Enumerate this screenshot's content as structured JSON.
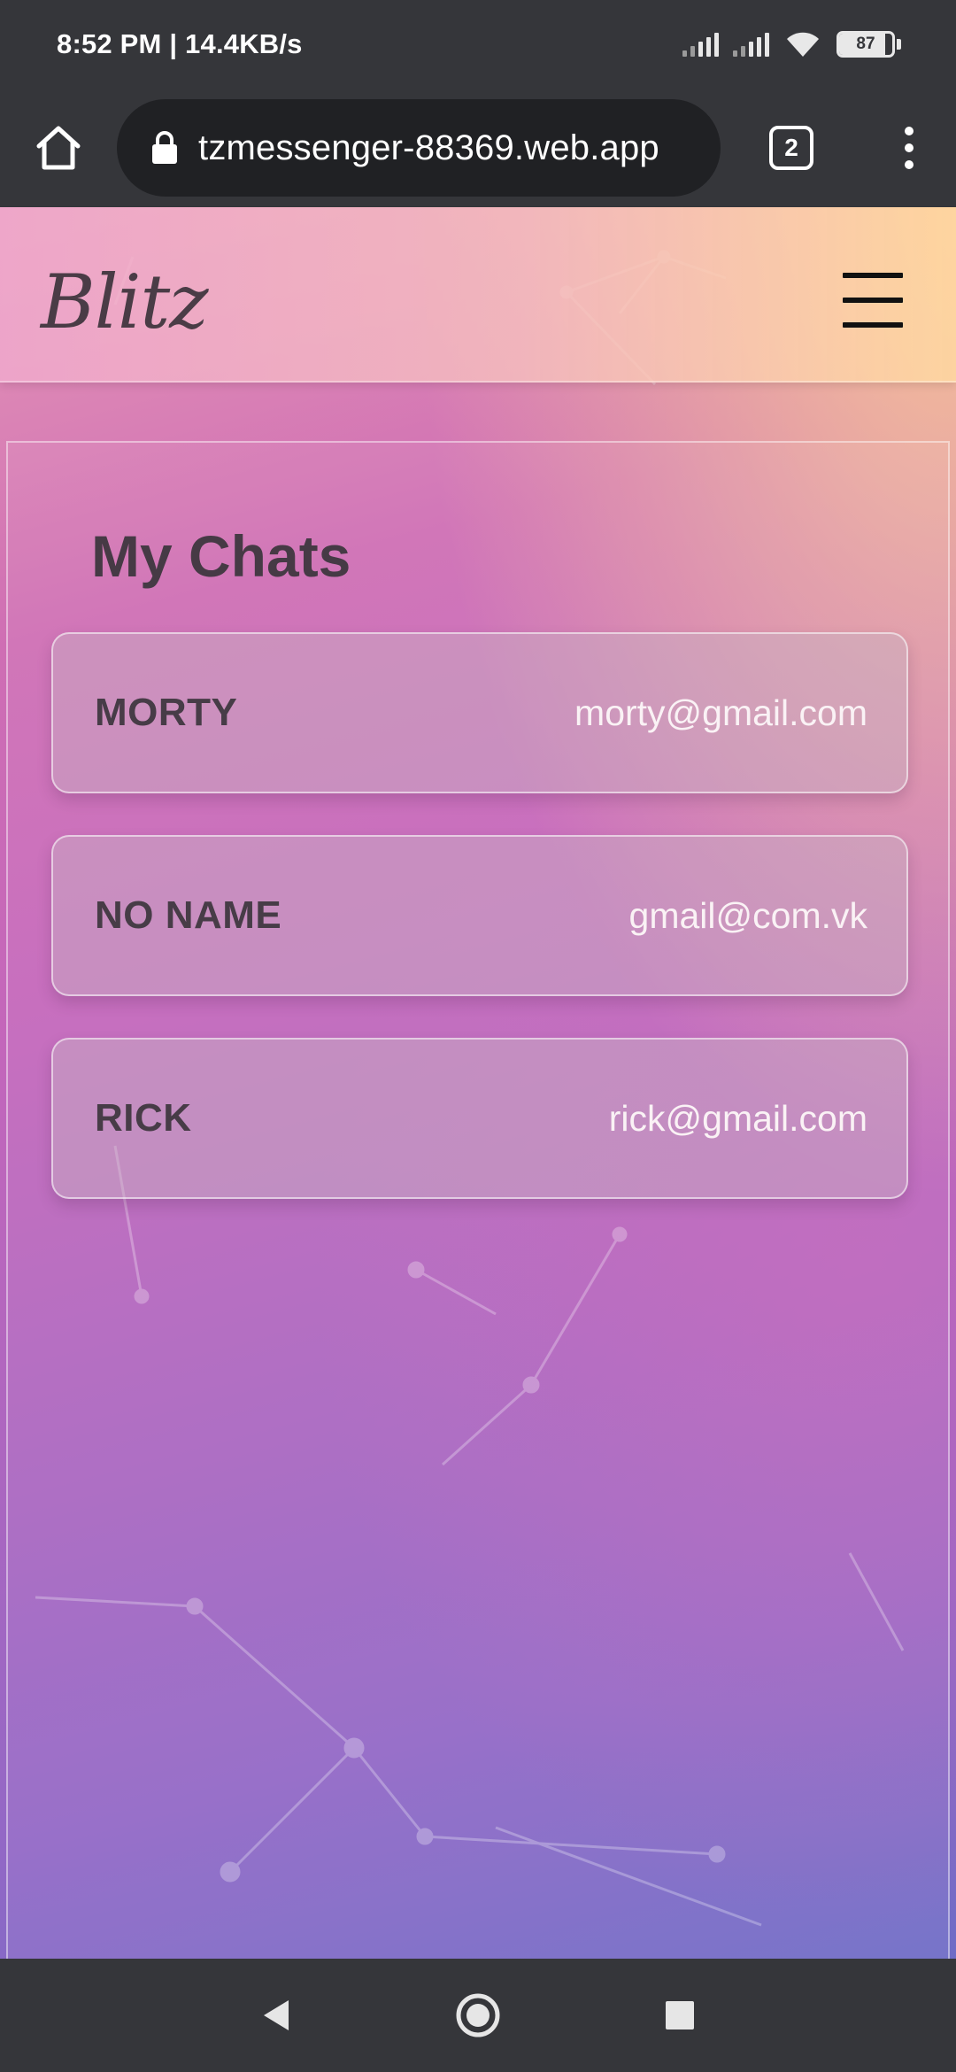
{
  "status_bar": {
    "time": "8:52 PM | 14.4KB/s",
    "battery": "87",
    "battery_level": 0.87
  },
  "browser": {
    "url": "tzmessenger-88369.web.app",
    "tab_count": "2",
    "icons": {
      "home": "home-icon",
      "lock": "lock-icon",
      "tabs": "tab-switcher-icon",
      "menu": "more-vert-icon"
    }
  },
  "app": {
    "logo": "Blitz",
    "menu_icon": "hamburger-icon"
  },
  "chats": {
    "title": "My Chats",
    "items": [
      {
        "name": "MORTY",
        "email": "morty@gmail.com"
      },
      {
        "name": "NO NAME",
        "email": "gmail@com.vk"
      },
      {
        "name": "RICK",
        "email": "rick@gmail.com"
      }
    ]
  },
  "nav_bar": {
    "icons": [
      "back-icon",
      "home-icon",
      "recents-icon"
    ]
  },
  "colors": {
    "status_bar": "#35363a",
    "url_field": "#202124",
    "text_dark": "#463a45",
    "email_text": "#faf2f5",
    "gradient_top": "#e597b6",
    "gradient_mid": "#c366bb",
    "gradient_bottom": "#6e6cc6"
  }
}
